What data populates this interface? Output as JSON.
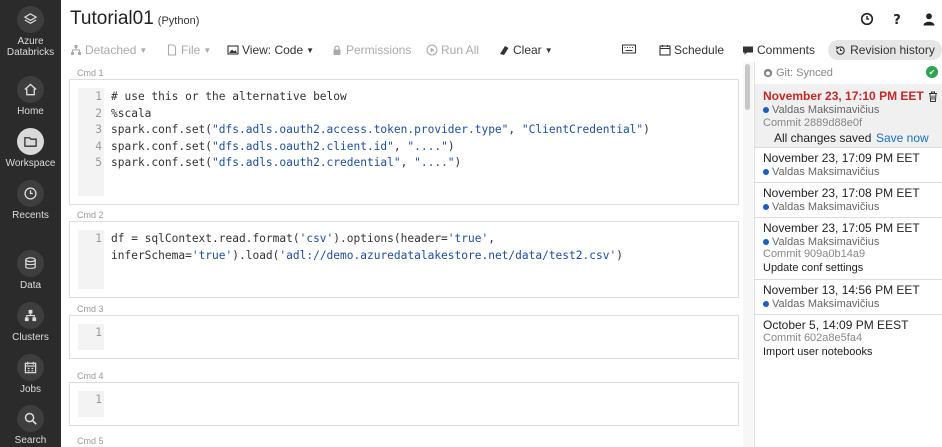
{
  "sidebar": {
    "brand_line1": "Azure",
    "brand_line2": "Databricks",
    "items": [
      {
        "label": "Home",
        "icon": "home-icon"
      },
      {
        "label": "Workspace",
        "icon": "folder-icon"
      },
      {
        "label": "Recents",
        "icon": "clock-icon"
      },
      {
        "label": "Data",
        "icon": "database-icon"
      },
      {
        "label": "Clusters",
        "icon": "cluster-icon"
      },
      {
        "label": "Jobs",
        "icon": "calendar-icon"
      },
      {
        "label": "Search",
        "icon": "search-icon"
      }
    ]
  },
  "header": {
    "title": "Tutorial01",
    "language": "(Python)"
  },
  "toolbar": {
    "detached": "Detached",
    "file": "File",
    "view": "View: Code",
    "permissions": "Permissions",
    "run_all": "Run All",
    "clear": "Clear",
    "schedule": "Schedule",
    "comments": "Comments",
    "revision_history": "Revision history"
  },
  "cells": [
    {
      "cmd": "Cmd  1",
      "lines": [
        {
          "n": "1",
          "parts": [
            {
              "t": "# use this or the alternative below"
            }
          ]
        },
        {
          "n": "2",
          "parts": [
            {
              "t": "%scala"
            }
          ]
        },
        {
          "n": "3",
          "parts": [
            {
              "t": "spark.conf.set("
            },
            {
              "t": "\"dfs.adls.oauth2.access.token.provider.type\"",
              "s": true
            },
            {
              "t": ", "
            },
            {
              "t": "\"ClientCredential\"",
              "s": true
            },
            {
              "t": ")"
            }
          ]
        },
        {
          "n": "4",
          "parts": [
            {
              "t": "spark.conf.set("
            },
            {
              "t": "\"dfs.adls.oauth2.client.id\"",
              "s": true
            },
            {
              "t": ", "
            },
            {
              "t": "\"....\"",
              "s": true
            },
            {
              "t": ")"
            }
          ]
        },
        {
          "n": "5",
          "parts": [
            {
              "t": "spark.conf.set("
            },
            {
              "t": "\"dfs.adls.oauth2.credential\"",
              "s": true
            },
            {
              "t": ", "
            },
            {
              "t": "\"....\"",
              "s": true
            },
            {
              "t": ")"
            }
          ]
        }
      ]
    },
    {
      "cmd": "Cmd  2",
      "lines": [
        {
          "n": "1",
          "parts": [
            {
              "t": "df = sqlContext.read.format("
            },
            {
              "t": "'csv'",
              "s": true
            },
            {
              "t": ").options(header="
            },
            {
              "t": "'true'",
              "s": true
            },
            {
              "t": ","
            }
          ]
        },
        {
          "n": "",
          "parts": [
            {
              "t": "inferSchema="
            },
            {
              "t": "'true'",
              "s": true
            },
            {
              "t": ").load("
            },
            {
              "t": "'adl://demo.azuredatalakestore.net/data/test2.csv'",
              "s": true
            },
            {
              "t": ")"
            }
          ]
        }
      ]
    },
    {
      "cmd": "Cmd  3",
      "lines": [
        {
          "n": "1",
          "parts": [
            {
              "t": ""
            }
          ]
        }
      ]
    },
    {
      "cmd": "Cmd  4",
      "lines": [
        {
          "n": "1",
          "parts": [
            {
              "t": ""
            }
          ]
        }
      ]
    },
    {
      "cmd": "Cmd  5",
      "lines": []
    }
  ],
  "panel": {
    "git_status": "Git: Synced",
    "revisions": [
      {
        "date": "November 23, 17:10 PM EET",
        "author": "Valdas Maksimavičius",
        "commit": "Commit 2889d88e0f",
        "saved": "All changes saved",
        "save_now": "Save now"
      },
      {
        "date": "November 23, 17:09 PM EET",
        "author": "Valdas Maksimavičius"
      },
      {
        "date": "November 23, 17:08 PM EET",
        "author": "Valdas Maksimavičius"
      },
      {
        "date": "November 23, 17:05 PM EET",
        "author": "Valdas Maksimavičius",
        "commit": "Commit 909a0b14a9",
        "message": "Update conf settings"
      },
      {
        "date": "November 13, 14:56 PM EET",
        "author": "Valdas Maksimavičius"
      },
      {
        "date": "October 5, 14:09 PM EEST",
        "commit": "Commit 602a8e5fa4",
        "message": "Import user notebooks"
      }
    ]
  }
}
